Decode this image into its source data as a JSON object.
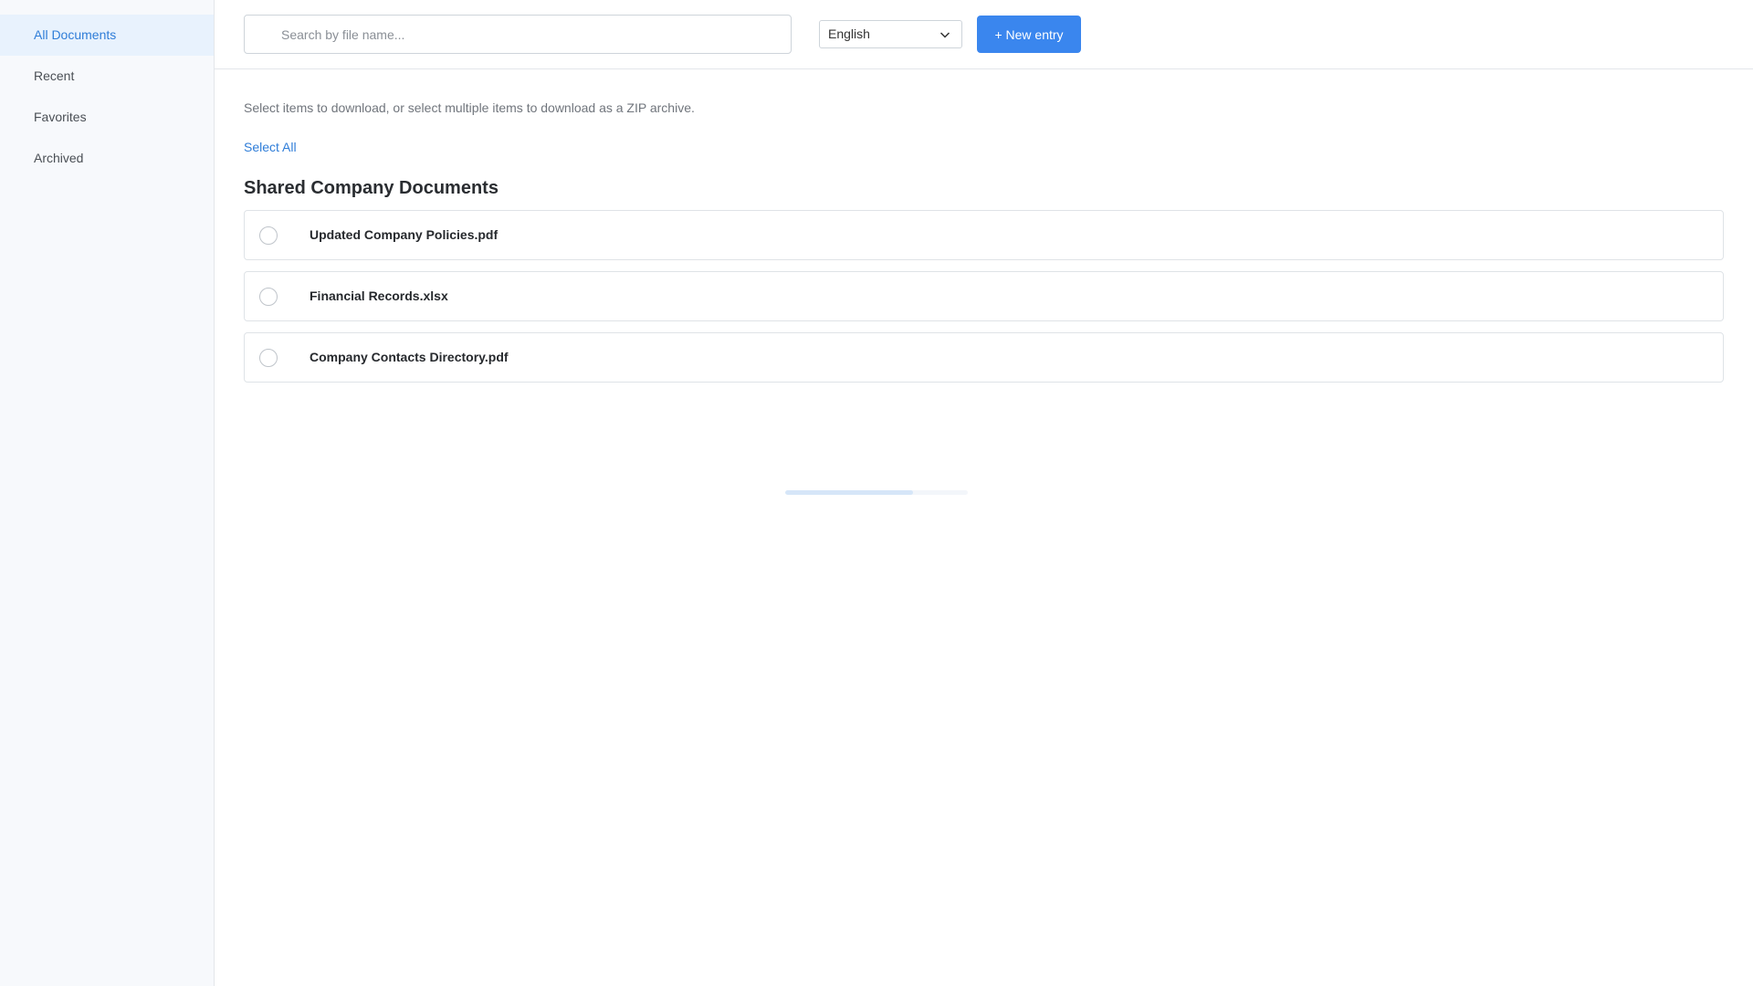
{
  "sidebar": {
    "items": [
      {
        "label": "All Documents",
        "active": true
      },
      {
        "label": "Recent",
        "active": false
      },
      {
        "label": "Favorites",
        "active": false
      },
      {
        "label": "Archived",
        "active": false
      }
    ]
  },
  "toolbar": {
    "search_placeholder": "Search by file name...",
    "search_value": "",
    "language": "English",
    "new_entry_label": "+ New entry"
  },
  "main": {
    "hint": "Select items to download, or select multiple items to download as a ZIP archive.",
    "select_all_label": "Select All",
    "section_title": "Shared Company Documents",
    "files": [
      {
        "name": "Updated Company Policies.pdf",
        "selected": false
      },
      {
        "name": "Financial Records.xlsx",
        "selected": false
      },
      {
        "name": "Company Contacts Directory.pdf",
        "selected": false
      }
    ],
    "loading_progress": 0.7
  },
  "colors": {
    "accent": "#3a86ee",
    "active_nav_bg": "#e8f2fd",
    "active_nav_text": "#2f7dd8"
  }
}
